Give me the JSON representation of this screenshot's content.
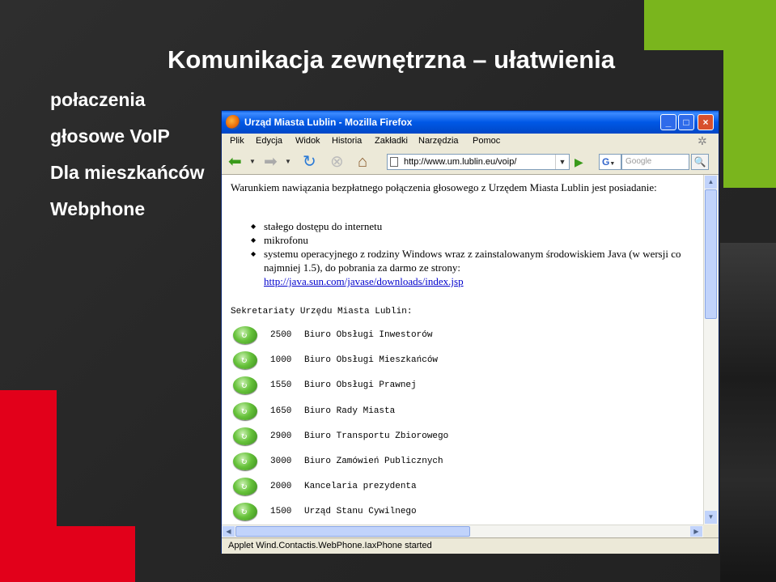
{
  "slide": {
    "title": "Komunikacja zewnętrzna – ułatwienia",
    "bullets": [
      "połaczenia",
      "głosowe VoIP",
      "Dla mieszkańców",
      "Webphone"
    ]
  },
  "browser": {
    "window_title": "Urząd Miasta Lublin - Mozilla Firefox",
    "menu": [
      "Plik",
      "Edycja",
      "Widok",
      "Historia",
      "Zakładki",
      "Narzędzia",
      "Pomoc"
    ],
    "url": "http://www.um.lublin.eu/voip/",
    "search_placeholder": "Google",
    "search_engine_icon": "G",
    "status": "Applet Wind.Contactis.WebPhone.IaxPhone started"
  },
  "page": {
    "intro": "Warunkiem nawiązania bezpłatnego połączenia głosowego z Urzędem Miasta Lublin jest posiadanie:",
    "requirements": [
      "stałego dostępu do internetu",
      "mikrofonu",
      "systemu operacyjnego z rodziny Windows wraz z zainstalowanym środowiskiem Java (w wersji co najmniej 1.5), do pobrania za darmo ze strony:"
    ],
    "java_link": "http://java.sun.com/javase/downloads/index.jsp",
    "secretariats_title": "Sekretariaty Urzędu Miasta Lublin:",
    "secretariats": [
      {
        "ext": "2500",
        "name": "Biuro Obsługi Inwestorów"
      },
      {
        "ext": "1000",
        "name": "Biuro Obsługi Mieszkańców"
      },
      {
        "ext": "1550",
        "name": "Biuro Obsługi Prawnej"
      },
      {
        "ext": "1650",
        "name": "Biuro Rady Miasta"
      },
      {
        "ext": "2900",
        "name": "Biuro Transportu Zbiorowego"
      },
      {
        "ext": "3000",
        "name": "Biuro Zamówień Publicznych"
      },
      {
        "ext": "2000",
        "name": "Kancelaria prezydenta"
      },
      {
        "ext": "1500",
        "name": "Urząd Stanu Cywilnego"
      }
    ]
  },
  "colors": {
    "green": "#7ab51d",
    "red": "#e2001a",
    "background": "#262626"
  }
}
